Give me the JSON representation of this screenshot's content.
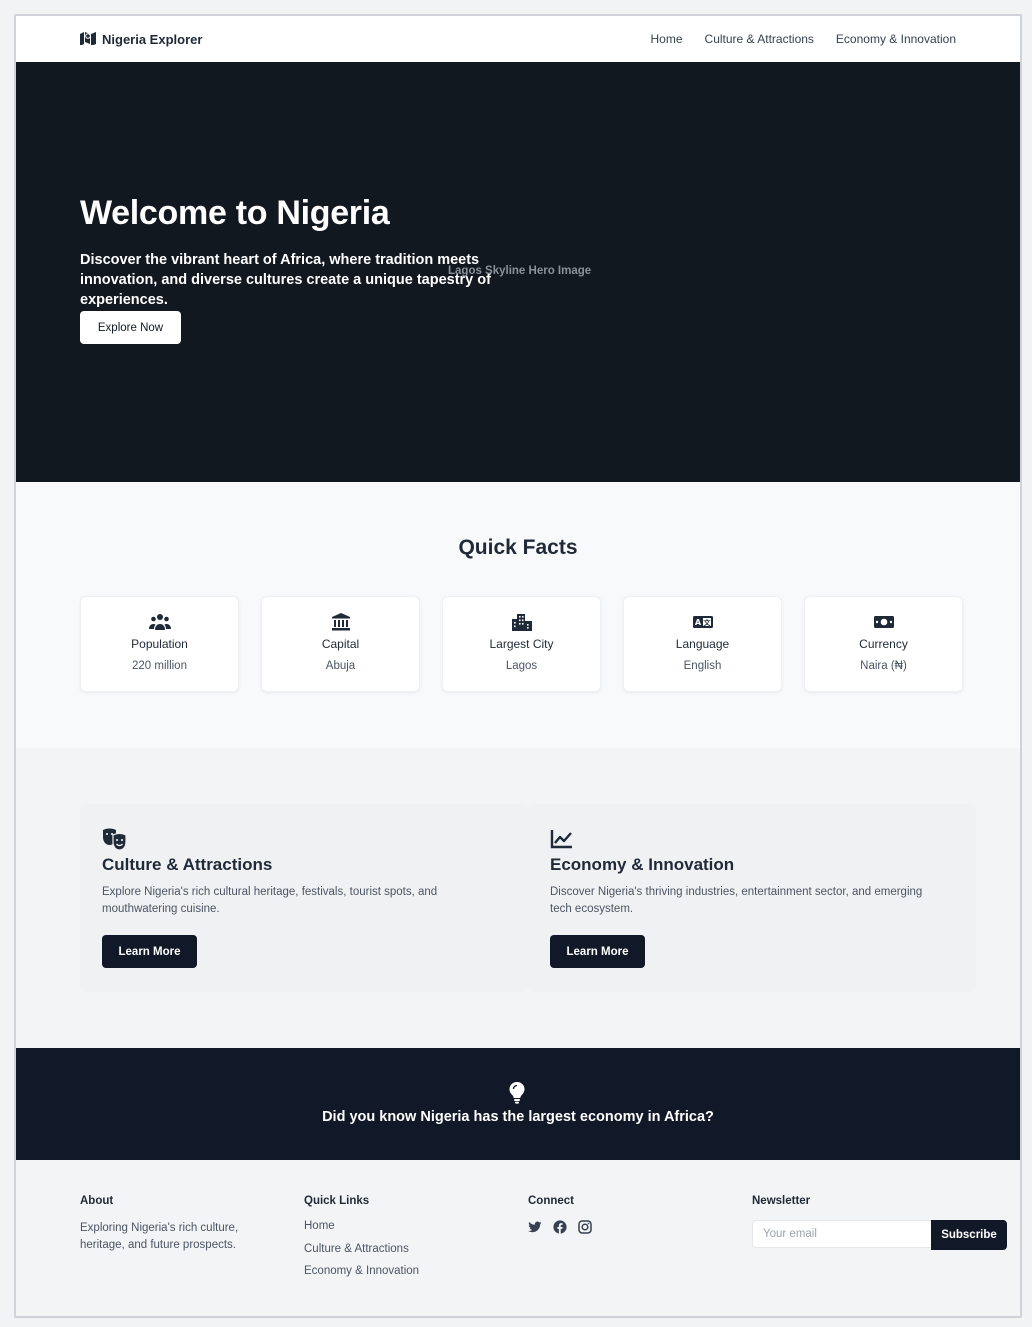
{
  "nav": {
    "brand": "Nigeria Explorer",
    "brand_icon": "map-icon",
    "links": [
      "Home",
      "Culture & Attractions",
      "Economy & Innovation"
    ]
  },
  "hero": {
    "title": "Welcome to Nigeria",
    "subtitle": "Discover the vibrant heart of Africa, where tradition meets innovation, and diverse cultures create a unique tapestry of experiences.",
    "image_alt": "Lagos Skyline Hero Image",
    "cta": "Explore Now",
    "background": "#121820"
  },
  "facts": {
    "title": "Quick Facts",
    "items": [
      {
        "icon": "people-icon",
        "label": "Population",
        "value": "220 million"
      },
      {
        "icon": "landmark-icon",
        "label": "Capital",
        "value": "Abuja"
      },
      {
        "icon": "city-icon",
        "label": "Largest City",
        "value": "Lagos"
      },
      {
        "icon": "language-icon",
        "label": "Language",
        "value": "English"
      },
      {
        "icon": "money-icon",
        "label": "Currency",
        "value": "Naira (₦)"
      }
    ]
  },
  "features": [
    {
      "icon": "theater-masks-icon",
      "title": "Culture & Attractions",
      "description": "Explore Nigeria's rich cultural heritage, festivals, tourist spots, and mouthwatering cuisine.",
      "button": "Learn More"
    },
    {
      "icon": "chart-line-icon",
      "title": "Economy & Innovation",
      "description": "Discover Nigeria's thriving industries, entertainment sector, and emerging tech ecosystem.",
      "button": "Learn More"
    }
  ],
  "banner": {
    "icon": "lightbulb-icon",
    "text": "Did you know Nigeria has the largest economy in Africa?"
  },
  "footer": {
    "about": {
      "title": "About",
      "text": "Exploring Nigeria's rich culture, heritage, and future prospects."
    },
    "quick_links": {
      "title": "Quick Links",
      "items": [
        "Home",
        "Culture & Attractions",
        "Economy & Innovation"
      ]
    },
    "connect": {
      "title": "Connect",
      "icons": [
        "twitter-icon",
        "facebook-icon",
        "instagram-icon"
      ]
    },
    "newsletter": {
      "title": "Newsletter",
      "placeholder": "Your email",
      "button": "Subscribe"
    }
  },
  "colors": {
    "dark": "#111827",
    "page_bg": "#f3f4f6",
    "card_bg": "#ffffff"
  }
}
